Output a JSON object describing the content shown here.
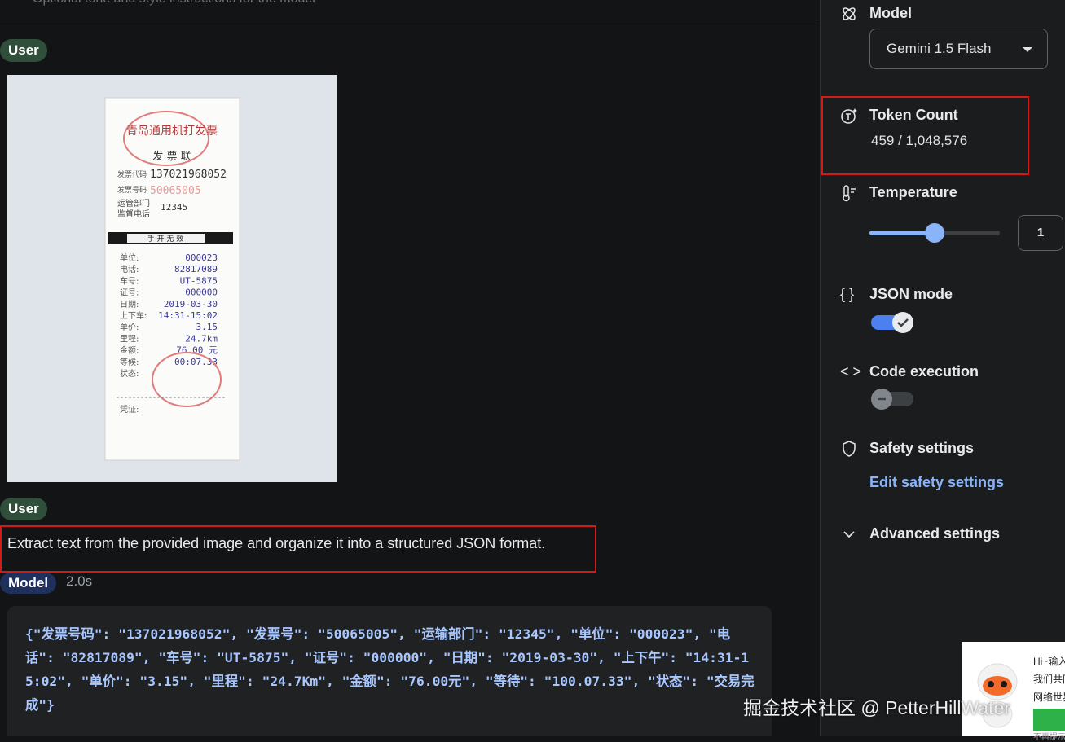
{
  "main": {
    "system_instructions_placeholder": "Optional tone and style instructions for the model",
    "messages": [
      {
        "role_label": "User",
        "type": "image"
      },
      {
        "role_label": "User",
        "type": "text",
        "text": "Extract text from the provided image and organize it into a structured JSON format."
      },
      {
        "role_label": "Model",
        "time": "2.0s",
        "type": "code"
      }
    ],
    "model_output": "{\"发票号码\": \"137021968052\", \"发票号\": \"50065005\", \"运输部门\": \"12345\", \"单位\": \"000023\", \"电话\": \"82817089\", \"车号\": \"UT-5875\", \"证号\": \"000000\", \"日期\": \"2019-03-30\", \"上下午\": \"14:31-15:02\", \"单价\": \"3.15\", \"里程\": \"24.7Km\", \"金额\": \"76.00元\", \"等待\": \"100.07.33\", \"状态\": \"交易完成\"}"
  },
  "receipt": {
    "header": "青岛通用机打发票",
    "subheader": "发 票 联",
    "invoice_code_label": "发票代码",
    "invoice_code": "137021968052",
    "invoice_no_label": "发票号码",
    "invoice_no": "50065005",
    "dept_label": "运管部门",
    "phone_label": "监督电话",
    "dept_value": "12345",
    "band": "手 开 无 效",
    "rows": [
      {
        "label": "单位:",
        "value": "000023"
      },
      {
        "label": "电话:",
        "value": "82817089"
      },
      {
        "label": "车号:",
        "value": "UT-5875"
      },
      {
        "label": "证号:",
        "value": "000000"
      },
      {
        "label": "日期:",
        "value": "2019-03-30"
      },
      {
        "label": "上下车:",
        "value": "14:31-15:02"
      },
      {
        "label": "单价:",
        "value": "3.15"
      },
      {
        "label": "里程:",
        "value": "24.7km"
      },
      {
        "label": "金额:",
        "value": "76.00 元"
      },
      {
        "label": "等候:",
        "value": "00:07.33"
      },
      {
        "label": "状态:",
        "value": ""
      }
    ],
    "footer": "凭证:"
  },
  "sidebar": {
    "model_title": "Model",
    "model_selected": "Gemini 1.5 Flash",
    "token_title": "Token Count",
    "token_value": "459 / 1,048,576",
    "temperature_title": "Temperature",
    "temperature_value": "1",
    "temperature_level": 0.5,
    "json_mode_title": "JSON mode",
    "json_mode_on": true,
    "code_exec_title": "Code execution",
    "code_exec_on": false,
    "safety_title": "Safety settings",
    "safety_link": "Edit safety settings",
    "advanced_title": "Advanced settings"
  },
  "overlay": {
    "watermark": "掘金技术社区 @ PetterHillWater",
    "popup_lines": [
      "Hi~输入",
      "我们共同",
      "网络世界"
    ],
    "popup_footer": "不再提示"
  },
  "colors": {
    "accent": "#8ab4f8",
    "highlight": "#d11a1a",
    "user_pill": "#2f4f3a",
    "model_pill": "#20305c"
  }
}
